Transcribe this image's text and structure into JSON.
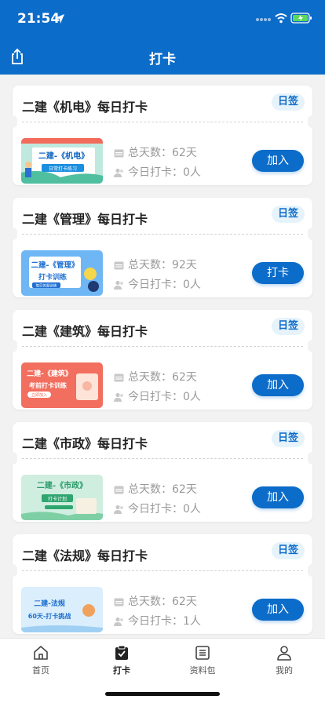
{
  "status_bar": {
    "time": "21:54"
  },
  "header": {
    "title": "打卡"
  },
  "colors": {
    "primary": "#0c6cc9",
    "tag_bg": "#e6f3fb",
    "page_bg": "#f2f2f2"
  },
  "cards": [
    {
      "title": "二建《机电》每日打卡",
      "tag": "日签",
      "total": "总天数：62天",
      "today": "今日打卡：0人",
      "button": "加入",
      "thumb_text": "二建-《机电》",
      "thumb_sub": "日常打卡练习"
    },
    {
      "title": "二建《管理》每日打卡",
      "tag": "日签",
      "total": "总天数：92天",
      "today": "今日打卡：0人",
      "button": "打卡",
      "thumb_text": "二建-《管理》",
      "thumb_sub": "打卡训练",
      "thumb_sub2": "每日答题训练"
    },
    {
      "title": "二建《建筑》每日打卡",
      "tag": "日签",
      "total": "总天数：62天",
      "today": "今日打卡：0人",
      "button": "加入",
      "thumb_text": "二建-《建筑》",
      "thumb_sub": "考前打卡训练",
      "thumb_sub2": "立即加入"
    },
    {
      "title": "二建《市政》每日打卡",
      "tag": "日签",
      "total": "总天数：62天",
      "today": "今日打卡：0人",
      "button": "加入",
      "thumb_text": "二建-《市政》",
      "thumb_sub": "打卡计划"
    },
    {
      "title": "二建《法规》每日打卡",
      "tag": "日签",
      "total": "总天数：62天",
      "today": "今日打卡：1人",
      "button": "加入",
      "thumb_text": "二建-法规",
      "thumb_sub": "60天-打卡挑战"
    }
  ],
  "tabbar": [
    {
      "label": "首页",
      "icon": "home-icon"
    },
    {
      "label": "打卡",
      "icon": "checkin-icon"
    },
    {
      "label": "资料包",
      "icon": "document-list-icon"
    },
    {
      "label": "我的",
      "icon": "profile-icon"
    }
  ]
}
